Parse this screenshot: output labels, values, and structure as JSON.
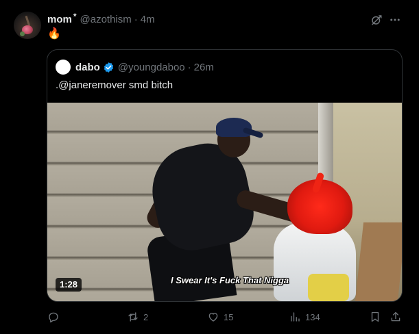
{
  "tweet": {
    "author_name": "mom",
    "author_star": "*",
    "author_handle": "@azothism",
    "separator": "·",
    "time": "4m",
    "text": "🔥"
  },
  "quote": {
    "author_name": "dabo",
    "author_handle": "@youngdaboo",
    "separator": "·",
    "time": "26m",
    "text": ".@janeremover smd bitch",
    "media": {
      "duration": "1:28",
      "caption": "I Swear It's Fuck That Nigga"
    }
  },
  "actions": {
    "replies": "",
    "reposts": "2",
    "likes": "15",
    "views": "134"
  },
  "icons": {
    "grok": "grok-slash-icon",
    "more": "more-icon",
    "verified": "verified-badge-icon",
    "reply": "reply-icon",
    "repost": "repost-icon",
    "like": "like-icon",
    "views": "views-icon",
    "bookmark": "bookmark-icon",
    "share": "share-icon"
  },
  "colors": {
    "background": "#000000",
    "text_primary": "#e7e9ea",
    "text_secondary": "#71767b",
    "border": "#2f3336",
    "verified_blue": "#1d9bf0",
    "hair_red": "#e01a10"
  }
}
